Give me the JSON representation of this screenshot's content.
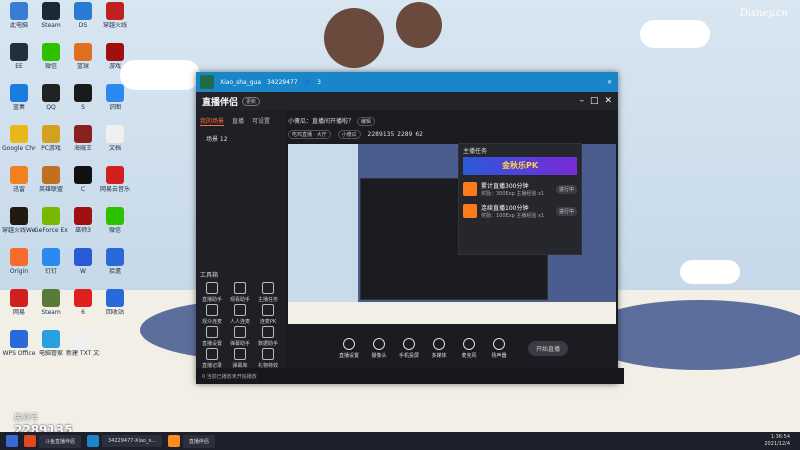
{
  "wallpaper": {
    "brand": "Disney.cn",
    "copyright": "©Disney"
  },
  "desktop_icons": [
    {
      "label": "此电脑",
      "color": "#3a7bd5"
    },
    {
      "label": "Steam",
      "color": "#1b2838"
    },
    {
      "label": "DS",
      "color": "#2a7bd5"
    },
    {
      "label": "穿越火线",
      "color": "#c02020"
    },
    {
      "label": "EE",
      "color": "#22303a"
    },
    {
      "label": "微信",
      "color": "#2dc100"
    },
    {
      "label": "篮球",
      "color": "#e07020"
    },
    {
      "label": "游戏",
      "color": "#a01010"
    },
    {
      "label": "蓝奏",
      "color": "#1a7be0"
    },
    {
      "label": "QQ",
      "color": "#222"
    },
    {
      "label": "S",
      "color": "#1a1a1a"
    },
    {
      "label": "识图",
      "color": "#2a8af0"
    },
    {
      "label": "Google Chrome",
      "color": "#e8b81a"
    },
    {
      "label": "PC游戏",
      "color": "#d4a020"
    },
    {
      "label": "海贼王",
      "color": "#8a2020"
    },
    {
      "label": "文档",
      "color": "#f0f0f0"
    },
    {
      "label": "迅雷",
      "color": "#f08020"
    },
    {
      "label": "英雄联盟",
      "color": "#c07020"
    },
    {
      "label": "C",
      "color": "#111"
    },
    {
      "label": "网易云音乐",
      "color": "#d22020"
    },
    {
      "label": "穿越火线WeGame",
      "color": "#201a10"
    },
    {
      "label": "GeForce Experience",
      "color": "#76b900"
    },
    {
      "label": "巫师3",
      "color": "#a01010"
    },
    {
      "label": "微信",
      "color": "#2dc100"
    },
    {
      "label": "Origin",
      "color": "#f56c2d"
    },
    {
      "label": "钉钉",
      "color": "#2a8af0"
    },
    {
      "label": "W",
      "color": "#2a5ad8"
    },
    {
      "label": "拾遗",
      "color": "#2a6ad8"
    },
    {
      "label": "网易",
      "color": "#d22020"
    },
    {
      "label": "Steam",
      "color": "#5a7a3a"
    },
    {
      "label": "6",
      "color": "#e02020"
    },
    {
      "label": "回收站",
      "color": "#2a6ad8"
    },
    {
      "label": "WPS Office",
      "color": "#2a6ad8"
    },
    {
      "label": "电脑管家",
      "color": "#2aa0e0"
    },
    {
      "label": "新建 TXT 文本文档",
      "color": "#f0f0f0"
    }
  ],
  "qq_bar": {
    "user": "Xiao_sha_gua",
    "id": "34229477",
    "viewers": "3"
  },
  "app": {
    "logo": "直播伴侣",
    "version": "更新",
    "sidebar_tabs": [
      "我的场景",
      "直播",
      "可设置"
    ],
    "scene": "场景 12",
    "tools_title": "工具箱",
    "tools": [
      "直播助手",
      "观看助手",
      "主播任务",
      "观众连麦",
      "人人连麦",
      "连麦PK",
      "直播设置",
      "弹幕助手",
      "数据助手",
      "直播记录",
      "弹幕库",
      "礼物特效"
    ],
    "room_title": "小傻瓜：直播间开播啦？",
    "edit": "编辑",
    "tags": [
      "吃鸡直播 · 大厅",
      "小傻瓜"
    ],
    "room_id": "2289135",
    "followers": "2289",
    "fans": "62"
  },
  "popup": {
    "title": "主播任务",
    "banner": "金秋乐PK",
    "tasks": [
      {
        "title": "累计直播300分钟",
        "sub": "奖励：300Exp 主播经验 x1",
        "btn": "进行中"
      },
      {
        "title": "连续直播100分钟",
        "sub": "奖励：100Exp 主播经验 x1",
        "btn": "进行中"
      }
    ]
  },
  "controls": [
    "直播设置",
    "摄像头",
    "手机投屏",
    "多媒体",
    "麦克风",
    "扬声器"
  ],
  "live_button": "开始直播",
  "status": "0 当前已播放未开始播放",
  "room_overlay": {
    "label": "房间号",
    "number": "2289135"
  },
  "taskbar": {
    "items": [
      "斗鱼直播伴侣",
      "34229477-Xiao_s...",
      "直播伴侣",
      "直播伴侣"
    ],
    "time": "1:36:54",
    "date": "2021/12/4"
  }
}
